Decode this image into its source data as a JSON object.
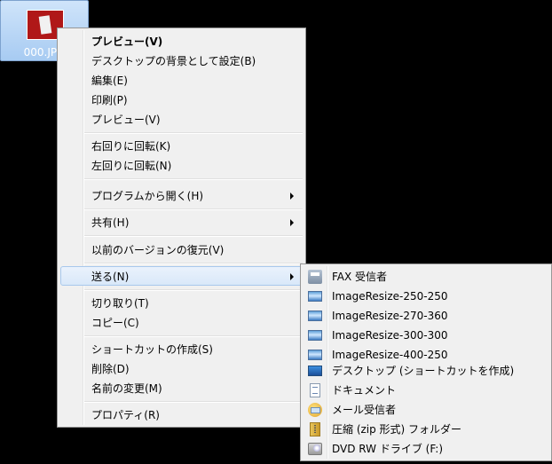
{
  "desktop": {
    "file_name": "000.JPG",
    "label_visible": "000.JPG"
  },
  "context_menu": {
    "items": [
      {
        "label": "プレビュー(V)"
      },
      {
        "label": "デスクトップの背景として設定(B)"
      },
      {
        "label": "編集(E)"
      },
      {
        "label": "印刷(P)"
      },
      {
        "label": "プレビュー(V)"
      },
      {
        "label": "右回りに回転(K)"
      },
      {
        "label": "左回りに回転(N)"
      },
      {
        "label": "プログラムから開く(H)"
      },
      {
        "label": "共有(H)"
      },
      {
        "label": "以前のバージョンの復元(V)"
      },
      {
        "label": "送る(N)"
      },
      {
        "label": "切り取り(T)"
      },
      {
        "label": "コピー(C)"
      },
      {
        "label": "ショートカットの作成(S)"
      },
      {
        "label": "削除(D)"
      },
      {
        "label": "名前の変更(M)"
      },
      {
        "label": "プロパティ(R)"
      }
    ]
  },
  "send_to_menu": {
    "items": [
      {
        "label": "FAX 受信者",
        "icon": "fax-icon"
      },
      {
        "label": "ImageResize-250-250",
        "icon": "image-icon"
      },
      {
        "label": "ImageResize-270-360",
        "icon": "image-icon"
      },
      {
        "label": "ImageResize-300-300",
        "icon": "image-icon"
      },
      {
        "label": "ImageResize-400-250",
        "icon": "image-icon"
      },
      {
        "label": "デスクトップ (ショートカットを作成)",
        "icon": "desktop-icon"
      },
      {
        "label": "ドキュメント",
        "icon": "document-icon"
      },
      {
        "label": "メール受信者",
        "icon": "mail-icon"
      },
      {
        "label": "圧縮 (zip 形式) フォルダー",
        "icon": "zip-folder-icon"
      },
      {
        "label": "DVD RW ドライブ (F:)",
        "icon": "dvd-drive-icon"
      }
    ]
  },
  "colors": {
    "highlight": "#d9e8f9",
    "menu_background": "#f0f0f0",
    "desktop_background": "#000000"
  }
}
